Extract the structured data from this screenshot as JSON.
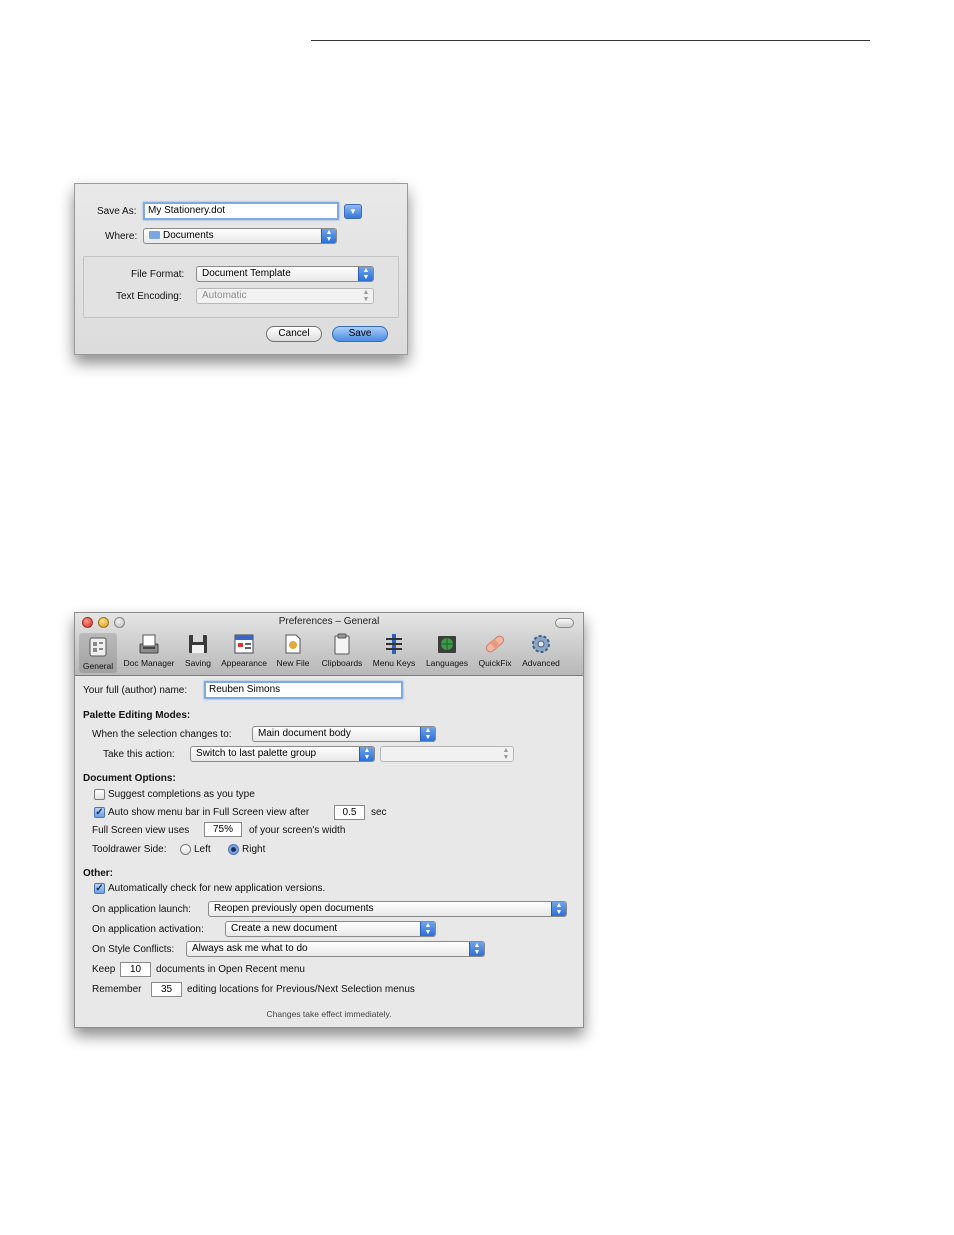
{
  "save_dialog": {
    "save_as_label": "Save As:",
    "filename": "My Stationery.dot",
    "where_label": "Where:",
    "where_value": "Documents",
    "file_format_label": "File Format:",
    "file_format_value": "Document Template",
    "text_encoding_label": "Text Encoding:",
    "text_encoding_value": "Automatic",
    "cancel_label": "Cancel",
    "save_label": "Save"
  },
  "prefs": {
    "window_title": "Preferences – General",
    "toolbar": [
      {
        "label": "General",
        "icon": "general-icon"
      },
      {
        "label": "Doc Manager",
        "icon": "doc-manager-icon"
      },
      {
        "label": "Saving",
        "icon": "floppy-disk-icon"
      },
      {
        "label": "Appearance",
        "icon": "appearance-icon"
      },
      {
        "label": "New File",
        "icon": "new-file-icon"
      },
      {
        "label": "Clipboards",
        "icon": "clipboard-icon"
      },
      {
        "label": "Menu Keys",
        "icon": "menu-keys-icon"
      },
      {
        "label": "Languages",
        "icon": "globe-book-icon"
      },
      {
        "label": "QuickFix",
        "icon": "bandage-icon"
      },
      {
        "label": "Advanced",
        "icon": "gear-icon"
      }
    ],
    "author_label": "Your full (author) name:",
    "author_value": "Reuben Simons",
    "palette_heading": "Palette Editing Modes:",
    "selection_changes_label": "When the selection changes to:",
    "selection_changes_value": "Main document body",
    "take_action_label": "Take this action:",
    "take_action_value": "Switch to last palette group",
    "take_action_secondary_value": "",
    "doc_options_heading": "Document Options:",
    "suggest_label": "Suggest completions as you type",
    "suggest_checked": false,
    "auto_menu_label": "Auto show menu bar in Full Screen view after",
    "auto_menu_checked": true,
    "auto_menu_value": "0.5",
    "auto_menu_unit": "sec",
    "fullscreen_label": "Full Screen view uses",
    "fullscreen_value": "75%",
    "fullscreen_suffix": "of your screen's width",
    "tooldrawer_label": "Tooldrawer Side:",
    "tooldrawer_left": "Left",
    "tooldrawer_right": "Right",
    "tooldrawer_selected": "Right",
    "other_heading": "Other:",
    "auto_check_label": "Automatically check for new application versions.",
    "auto_check_checked": true,
    "launch_label": "On application launch:",
    "launch_value": "Reopen previously open documents",
    "activation_label": "On application activation:",
    "activation_value": "Create a new document",
    "style_conflicts_label": "On Style Conflicts:",
    "style_conflicts_value": "Always ask me what to do",
    "keep_label": "Keep",
    "keep_value": "10",
    "keep_suffix": "documents in Open Recent menu",
    "remember_label": "Remember",
    "remember_value": "35",
    "remember_suffix": "editing locations for Previous/Next Selection menus",
    "note": "Changes take effect immediately."
  }
}
